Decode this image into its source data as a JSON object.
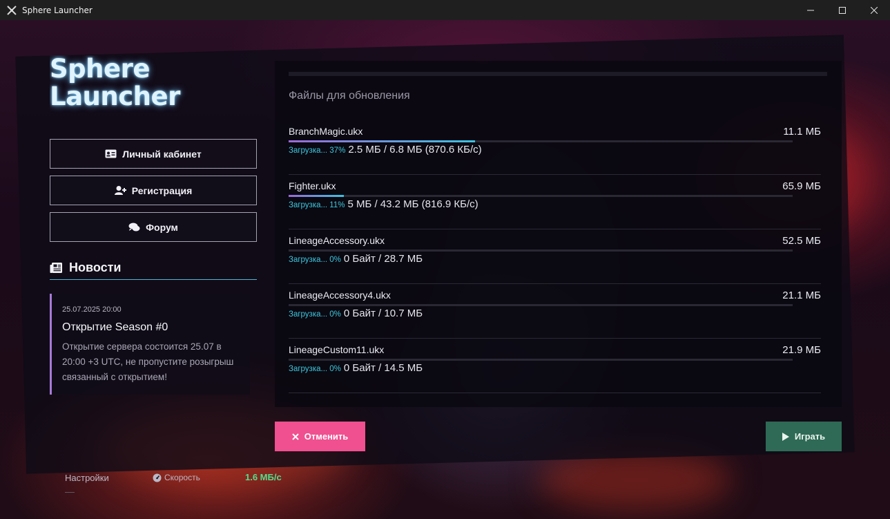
{
  "window": {
    "title": "Sphere Launcher",
    "icon": "crossed-swords-icon",
    "controls": [
      "minimize-icon",
      "maximize-icon",
      "close-icon"
    ]
  },
  "logo": {
    "line1": "Sphere",
    "line2": "Launcher"
  },
  "menu": [
    {
      "label": "Личный кабинет",
      "icon": "id-card-icon"
    },
    {
      "label": "Регистрация",
      "icon": "user-plus-icon"
    },
    {
      "label": "Форум",
      "icon": "comments-icon"
    }
  ],
  "news": {
    "title": "Новости",
    "icon": "newspaper-icon",
    "items": [
      {
        "date": "25.07.2025 20:00",
        "headline": "Открытие Season #0",
        "body": "Открытие сервера состоится 25.07 в 20:00 +3 UTC, не пропустите розыгрыш связанный с открытием!"
      }
    ]
  },
  "files": {
    "heading": "Файлы для обновления",
    "items": [
      {
        "name": "BranchMagic.ukx",
        "size": "11.1 МБ",
        "status": "Загрузка... 37%",
        "detail": "2.5 МБ / 6.8 МБ (870.6 КБ/с)",
        "progress": 0.37
      },
      {
        "name": "Fighter.ukx",
        "size": "65.9 МБ",
        "status": "Загрузка... 11%",
        "detail": "5 МБ / 43.2 МБ (816.9 КБ/с)",
        "progress": 0.11
      },
      {
        "name": "LineageAccessory.ukx",
        "size": "52.5 МБ",
        "status": "Загрузка... 0%",
        "detail": "0 Байт / 28.7 МБ",
        "progress": 0
      },
      {
        "name": "LineageAccessory4.ukx",
        "size": "21.1 МБ",
        "status": "Загрузка... 0%",
        "detail": "0 Байт / 10.7 МБ",
        "progress": 0
      },
      {
        "name": "LineageCustom11.ukx",
        "size": "21.9 МБ",
        "status": "Загрузка... 0%",
        "detail": "0 Байт / 14.5 МБ",
        "progress": 0
      }
    ]
  },
  "actions": {
    "cancel_label": "Отменить",
    "play_label": "Играть"
  },
  "footer": {
    "settings_label": "Настройки",
    "speed_label": "Скорость",
    "speed_value": "1.6 МБ/с"
  },
  "colors": {
    "accent_cyan": "#3cc8df",
    "accent_pink": "#f0508f",
    "play_green": "#2e6a55",
    "speed_green": "#4fe08d",
    "progress_purple": "#9b6ad8"
  }
}
